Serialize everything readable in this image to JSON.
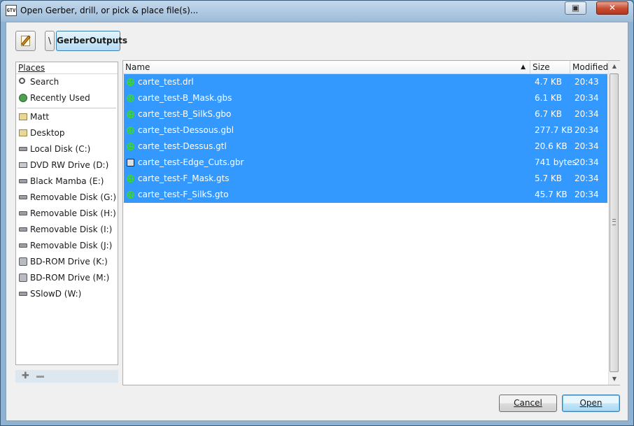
{
  "window": {
    "title": "Open Gerber, drill, or pick & place file(s)...",
    "app_icon_label": "GTV"
  },
  "pathbar": {
    "root_label": "\\",
    "current_folder": "GerberOutputs"
  },
  "places": {
    "header": "Places",
    "items": [
      {
        "label": "Search",
        "icon": "search-icon"
      },
      {
        "label": "Recently Used",
        "icon": "recent-icon"
      },
      {
        "label": "Matt",
        "icon": "folder-icon"
      },
      {
        "label": "Desktop",
        "icon": "folder-icon"
      },
      {
        "label": "Local Disk (C:)",
        "icon": "drive-icon"
      },
      {
        "label": "DVD RW Drive (D:)",
        "icon": "dvd-drive-icon"
      },
      {
        "label": "Black Mamba (E:)",
        "icon": "drive-icon"
      },
      {
        "label": "Removable Disk (G:)",
        "icon": "drive-icon"
      },
      {
        "label": "Removable Disk (H:)",
        "icon": "drive-icon"
      },
      {
        "label": "Removable Disk (I:)",
        "icon": "drive-icon"
      },
      {
        "label": "Removable Disk (J:)",
        "icon": "drive-icon"
      },
      {
        "label": "BD-ROM Drive (K:)",
        "icon": "optical-drive-icon"
      },
      {
        "label": "BD-ROM Drive (M:)",
        "icon": "optical-drive-icon"
      },
      {
        "label": "SSlowD (W:)",
        "icon": "drive-icon"
      }
    ]
  },
  "files": {
    "columns": {
      "name": "Name",
      "size": "Size",
      "modified": "Modified"
    },
    "rows": [
      {
        "name": "carte_test.drl",
        "size": "4.7 KB",
        "modified": "20:43",
        "icon": "gerber-file-icon"
      },
      {
        "name": "carte_test-B_Mask.gbs",
        "size": "6.1 KB",
        "modified": "20:34",
        "icon": "gerber-file-icon"
      },
      {
        "name": "carte_test-B_SilkS.gbo",
        "size": "6.7 KB",
        "modified": "20:34",
        "icon": "gerber-file-icon"
      },
      {
        "name": "carte_test-Dessous.gbl",
        "size": "277.7 KB",
        "modified": "20:34",
        "icon": "gerber-file-icon"
      },
      {
        "name": "carte_test-Dessus.gtl",
        "size": "20.6 KB",
        "modified": "20:34",
        "icon": "gerber-file-icon"
      },
      {
        "name": "carte_test-Edge_Cuts.gbr",
        "size": "741 bytes",
        "modified": "20:34",
        "icon": "document-file-icon"
      },
      {
        "name": "carte_test-F_Mask.gts",
        "size": "5.7 KB",
        "modified": "20:34",
        "icon": "gerber-file-icon"
      },
      {
        "name": "carte_test-F_SilkS.gto",
        "size": "45.7 KB",
        "modified": "20:34",
        "icon": "gerber-file-icon"
      }
    ]
  },
  "buttons": {
    "cancel": "Cancel",
    "open": "Open"
  },
  "colors": {
    "selection": "#3399ff",
    "gerber_icon": "#39d339"
  }
}
